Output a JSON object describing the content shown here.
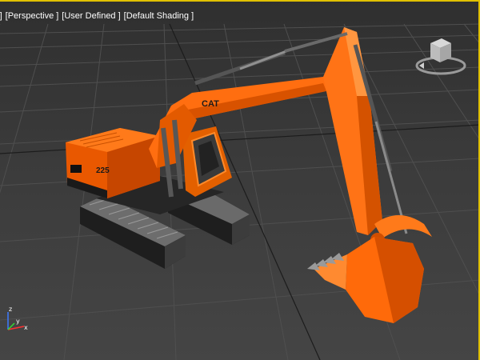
{
  "viewport": {
    "labels": {
      "menu": "[ + ]",
      "view": "[Perspective ]",
      "camera": "[User Defined ]",
      "shading": "[Default Shading ]"
    },
    "model": {
      "brand": "CAT",
      "model_number": "225"
    },
    "axis": {
      "x": "x",
      "y": "y",
      "z": "z"
    }
  }
}
